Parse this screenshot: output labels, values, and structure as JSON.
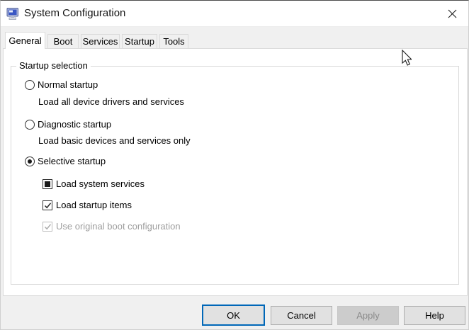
{
  "window": {
    "title": "System Configuration"
  },
  "tabs": [
    {
      "label": "General",
      "active": true
    },
    {
      "label": "Boot",
      "active": false
    },
    {
      "label": "Services",
      "active": false
    },
    {
      "label": "Startup",
      "active": false
    },
    {
      "label": "Tools",
      "active": false
    }
  ],
  "group": {
    "title": "Startup selection"
  },
  "startup_options": [
    {
      "label": "Normal startup",
      "description": "Load all device drivers and services",
      "selected": false
    },
    {
      "label": "Diagnostic startup",
      "description": "Load basic devices and services only",
      "selected": false
    },
    {
      "label": "Selective startup",
      "selected": true
    }
  ],
  "selective_sub_options": [
    {
      "label": "Load system services",
      "state": "indeterminate",
      "enabled": true
    },
    {
      "label": "Load startup items",
      "state": "checked",
      "enabled": true
    },
    {
      "label": "Use original boot configuration",
      "state": "checked",
      "enabled": false
    }
  ],
  "buttons": [
    {
      "label": "OK",
      "default": true,
      "enabled": true
    },
    {
      "label": "Cancel",
      "default": false,
      "enabled": true
    },
    {
      "label": "Apply",
      "default": false,
      "enabled": false
    },
    {
      "label": "Help",
      "default": false,
      "enabled": true
    }
  ],
  "colors": {
    "accent_focus": "#0067b8",
    "dialog_bg": "#f0f0f0",
    "titlebar_bg": "#ffffff",
    "panel_bg": "#ffffff",
    "button_face": "#e1e1e1",
    "button_border": "#adadad",
    "disabled_button_face": "#cccccc",
    "disabled_text": "#9e9e9e",
    "icon_screen_blue": "#3a57c4"
  }
}
